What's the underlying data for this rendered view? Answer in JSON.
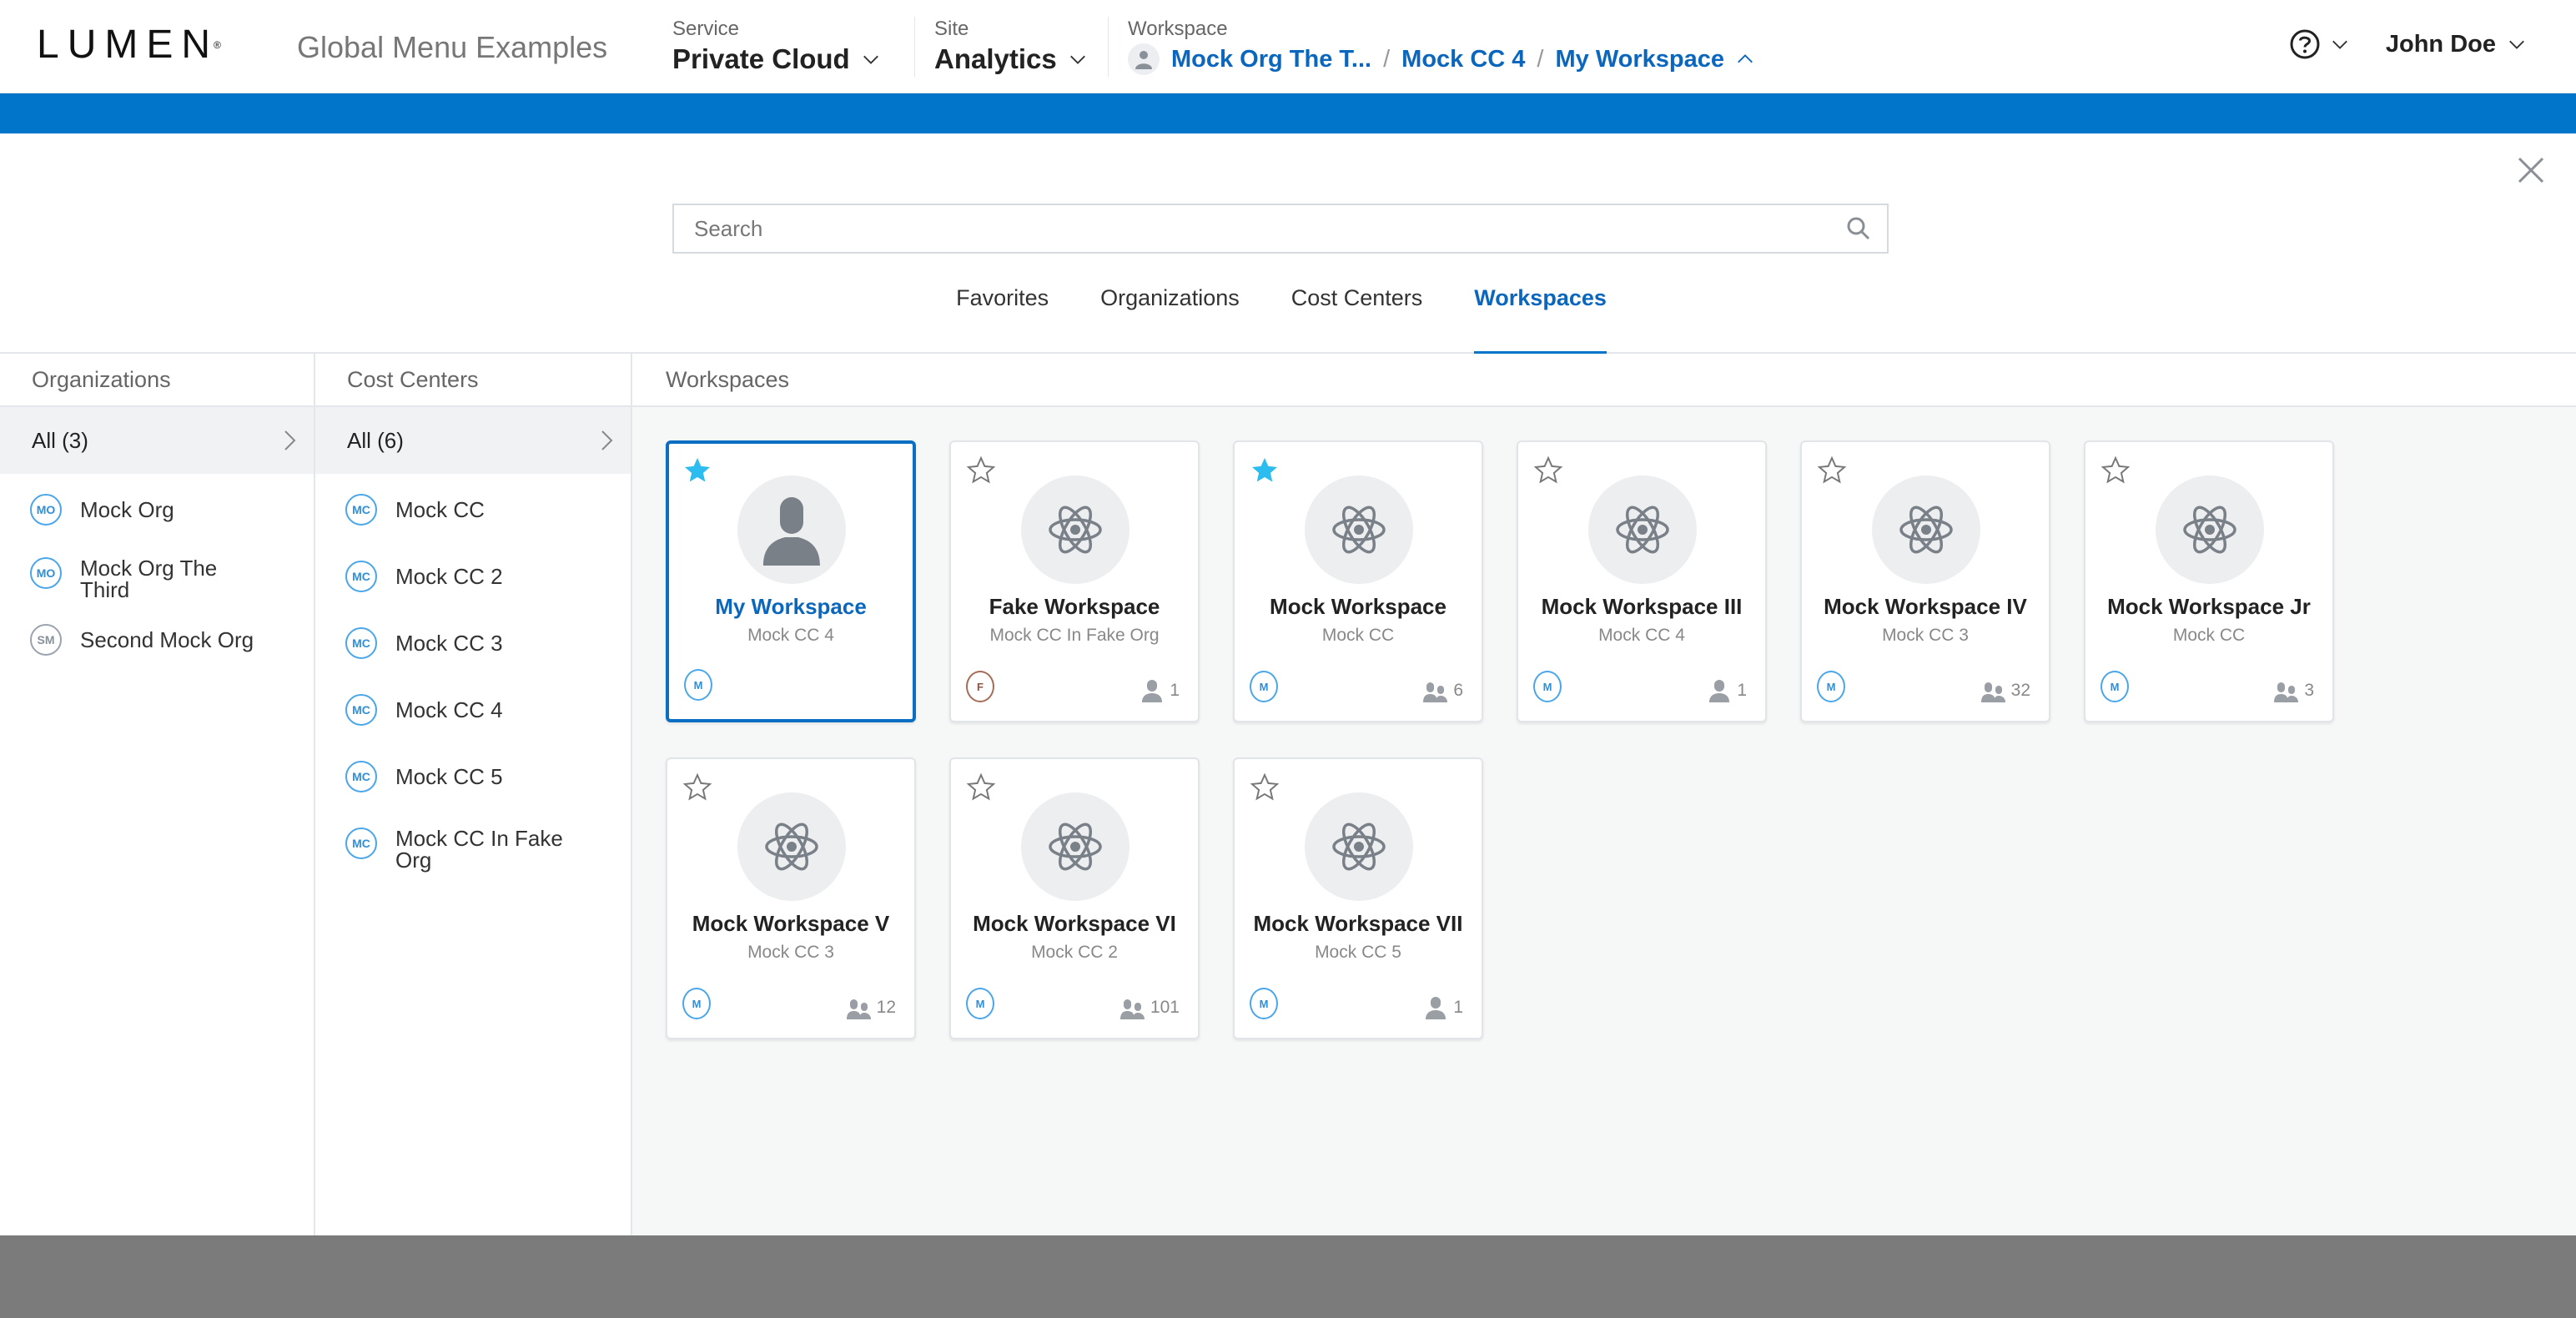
{
  "header": {
    "logo_text": "LUMEN",
    "logo_mark": "®",
    "app_title": "Global Menu Examples",
    "service": {
      "label": "Service",
      "value": "Private Cloud"
    },
    "site": {
      "label": "Site",
      "value": "Analytics"
    },
    "workspace": {
      "label": "Workspace",
      "breadcrumb": [
        "Mock Org The T...",
        "Mock CC 4",
        "My Workspace"
      ],
      "separator": "/"
    },
    "help_icon": "help-circle-icon",
    "user_name": "John Doe"
  },
  "colors": {
    "brand_blue": "#0075c9",
    "link_blue": "#0b67bd",
    "favorite_star": "#2bbcf0",
    "overlay": "#7b7b7b"
  },
  "panel": {
    "search": {
      "placeholder": "Search",
      "value": ""
    },
    "tabs": [
      {
        "label": "Favorites",
        "active": false
      },
      {
        "label": "Organizations",
        "active": false
      },
      {
        "label": "Cost Centers",
        "active": false
      },
      {
        "label": "Workspaces",
        "active": true
      }
    ],
    "organizations": {
      "header": "Organizations",
      "all_label": "All (3)",
      "items": [
        {
          "initials": "MO",
          "label": "Mock Org",
          "badge_color": "blue"
        },
        {
          "initials": "MO",
          "label": "Mock Org The Third",
          "badge_color": "blue"
        },
        {
          "initials": "SM",
          "label": "Second Mock Org",
          "badge_color": "gray"
        }
      ]
    },
    "cost_centers": {
      "header": "Cost Centers",
      "all_label": "All (6)",
      "items": [
        {
          "initials": "MC",
          "label": "Mock CC"
        },
        {
          "initials": "MC",
          "label": "Mock CC 2"
        },
        {
          "initials": "MC",
          "label": "Mock CC 3"
        },
        {
          "initials": "MC",
          "label": "Mock CC 4"
        },
        {
          "initials": "MC",
          "label": "Mock CC 5"
        },
        {
          "initials": "MC",
          "label": "Mock CC In Fake Org"
        }
      ]
    },
    "workspaces": {
      "header": "Workspaces",
      "cards": [
        {
          "name": "My Workspace",
          "cost_center": "Mock CC 4",
          "favorite": true,
          "selected": true,
          "icon": "person-icon",
          "org_initial": "M",
          "org_color": "blue",
          "members": null,
          "members_icon": null
        },
        {
          "name": "Fake Workspace",
          "cost_center": "Mock CC In Fake Org",
          "favorite": false,
          "selected": false,
          "icon": "atom-icon",
          "org_initial": "F",
          "org_color": "brown",
          "members": "1",
          "members_icon": "single-user-icon"
        },
        {
          "name": "Mock Workspace",
          "cost_center": "Mock CC",
          "favorite": true,
          "selected": false,
          "icon": "atom-icon",
          "org_initial": "M",
          "org_color": "blue",
          "members": "6",
          "members_icon": "group-users-icon"
        },
        {
          "name": "Mock Workspace III",
          "cost_center": "Mock CC 4",
          "favorite": false,
          "selected": false,
          "icon": "atom-icon",
          "org_initial": "M",
          "org_color": "blue",
          "members": "1",
          "members_icon": "single-user-icon"
        },
        {
          "name": "Mock Workspace IV",
          "cost_center": "Mock CC 3",
          "favorite": false,
          "selected": false,
          "icon": "atom-icon",
          "org_initial": "M",
          "org_color": "blue",
          "members": "32",
          "members_icon": "group-users-icon"
        },
        {
          "name": "Mock Workspace Jr",
          "cost_center": "Mock CC",
          "favorite": false,
          "selected": false,
          "icon": "atom-icon",
          "org_initial": "M",
          "org_color": "blue",
          "members": "3",
          "members_icon": "group-users-icon"
        },
        {
          "name": "Mock Workspace V",
          "cost_center": "Mock CC 3",
          "favorite": false,
          "selected": false,
          "icon": "atom-icon",
          "org_initial": "M",
          "org_color": "blue",
          "members": "12",
          "members_icon": "group-users-icon"
        },
        {
          "name": "Mock Workspace VI",
          "cost_center": "Mock CC 2",
          "favorite": false,
          "selected": false,
          "icon": "atom-icon",
          "org_initial": "M",
          "org_color": "blue",
          "members": "101",
          "members_icon": "group-users-icon"
        },
        {
          "name": "Mock Workspace VII",
          "cost_center": "Mock CC 5",
          "favorite": false,
          "selected": false,
          "icon": "atom-icon",
          "org_initial": "M",
          "org_color": "blue",
          "members": "1",
          "members_icon": "single-user-icon"
        }
      ]
    }
  }
}
